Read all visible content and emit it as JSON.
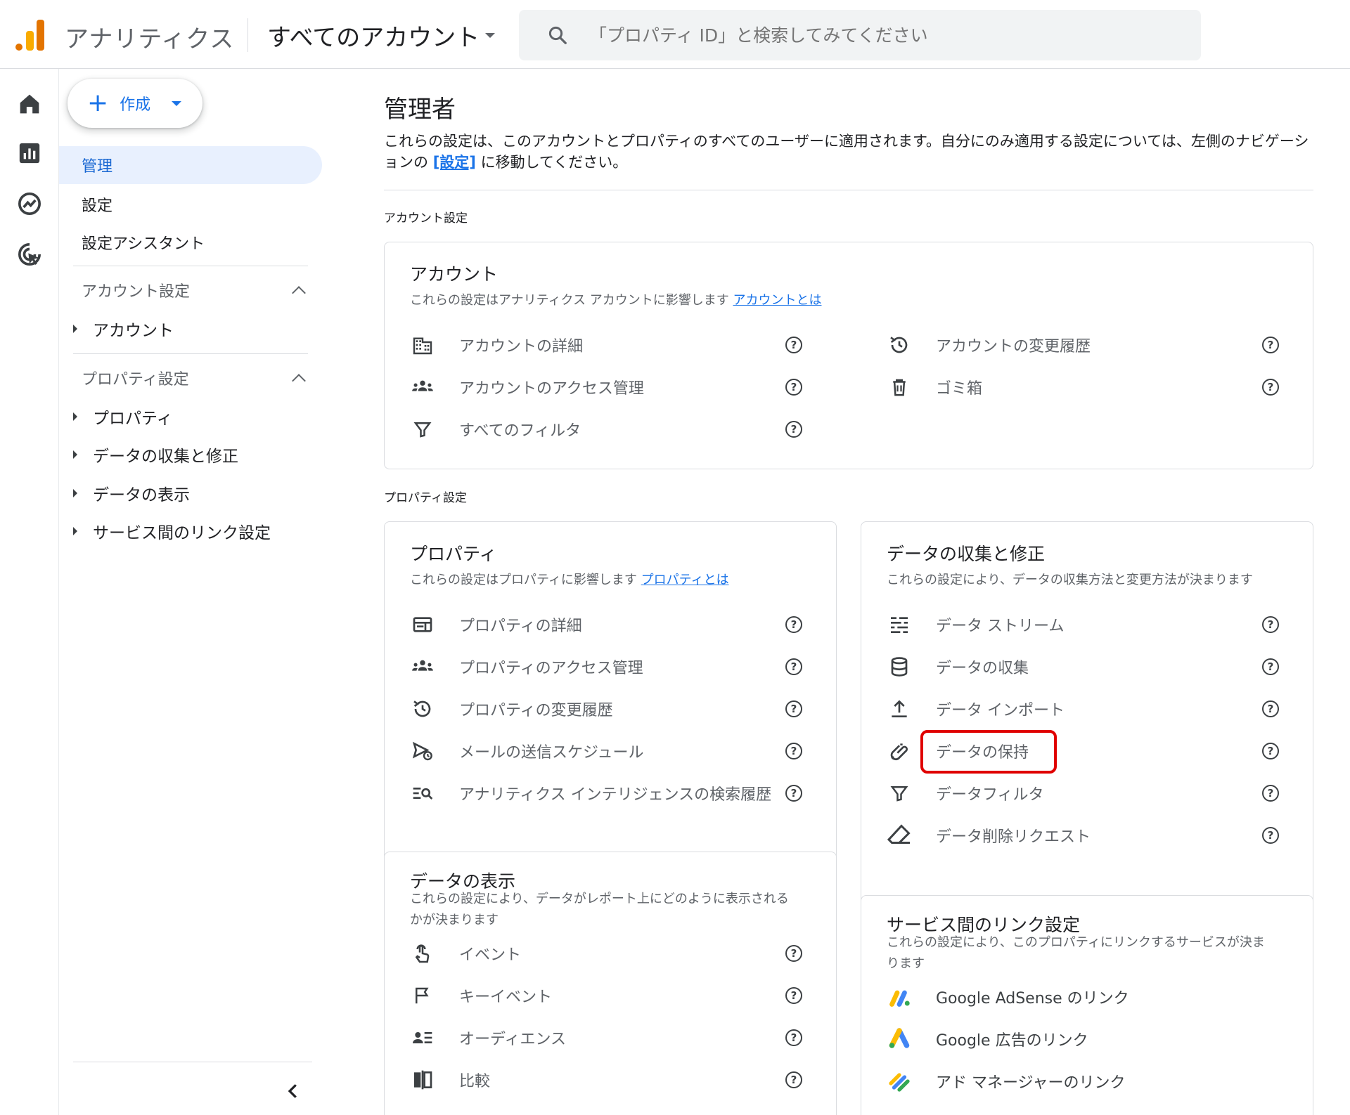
{
  "header": {
    "app_name": "アナリティクス",
    "account_switcher": "すべてのアカウント",
    "search_placeholder": "「プロパティ ID」と検索してみてください"
  },
  "nav": {
    "create_label": "作成",
    "items": [
      {
        "label": "管理",
        "active": true
      },
      {
        "label": "設定"
      },
      {
        "label": "設定アシスタント"
      }
    ],
    "account_section": {
      "label": "アカウント設定",
      "children": [
        "アカウント"
      ]
    },
    "property_section": {
      "label": "プロパティ設定",
      "children": [
        "プロパティ",
        "データの収集と修正",
        "データの表示",
        "サービス間のリンク設定"
      ]
    }
  },
  "main": {
    "title": "管理者",
    "desc_before": "これらの設定は、このアカウントとプロパティのすべてのユーザーに適用されます。自分にのみ適用する設定については、左側のナビゲーションの ",
    "desc_link": "[設定]",
    "desc_after": " に移動してください。",
    "account_settings_label": "アカウント設定",
    "property_settings_label": "プロパティ設定",
    "account_card": {
      "title": "アカウント",
      "desc": "これらの設定はアナリティクス アカウントに影響します",
      "desc_link": "アカウントとは",
      "left": [
        "アカウントの詳細",
        "アカウントのアクセス管理",
        "すべてのフィルタ"
      ],
      "right": [
        "アカウントの変更履歴",
        "ゴミ箱"
      ]
    },
    "property_card": {
      "title": "プロパティ",
      "desc": "これらの設定はプロパティに影響します",
      "desc_link": "プロパティとは",
      "items": [
        "プロパティの詳細",
        "プロパティのアクセス管理",
        "プロパティの変更履歴",
        "メールの送信スケジュール",
        "アナリティクス インテリジェンスの検索履歴"
      ]
    },
    "data_collection_card": {
      "title": "データの収集と修正",
      "desc": "これらの設定により、データの収集方法と変更方法が決まります",
      "items": [
        "データ ストリーム",
        "データの収集",
        "データ インポート",
        "データの保持",
        "データフィルタ",
        "データ削除リクエスト"
      ]
    },
    "data_display_card": {
      "title": "データの表示",
      "desc_line1": "これらの設定により、データがレポート上にどのように表示される",
      "desc_line2": "かが決まります",
      "items": [
        "イベント",
        "キーイベント",
        "オーディエンス",
        "比較"
      ]
    },
    "links_card": {
      "title": "サービス間のリンク設定",
      "desc_line1": "これらの設定により、このプロパティにリンクするサービスが決ま",
      "desc_line2": "ります",
      "items": [
        "Google AdSense のリンク",
        "Google 広告のリンク",
        "アド マネージャーのリンク"
      ]
    },
    "help_symbol": "?"
  },
  "colors": {
    "accent": "#1a73e8",
    "active_bg": "#e8f0fe",
    "highlight": "#e00000",
    "ga_orange": "#e37400",
    "ga_yellow": "#f9ab00"
  }
}
